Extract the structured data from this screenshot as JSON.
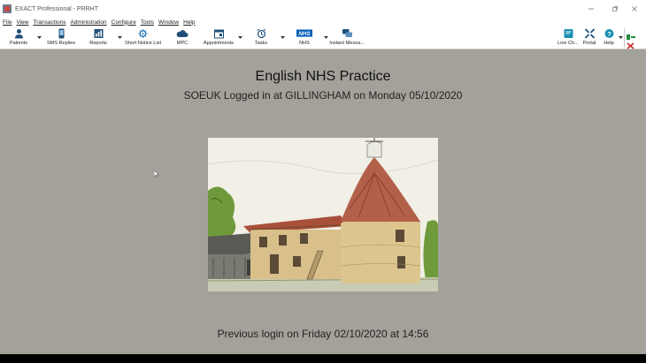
{
  "window": {
    "title": "EXACT Professional - PRRHT"
  },
  "menubar": {
    "items": [
      "File",
      "View",
      "Transactions",
      "Administration",
      "Configure",
      "Tools",
      "Window",
      "Help"
    ]
  },
  "toolbar": {
    "patients": "Patients",
    "sms_replies": "SMS Replies",
    "reports": "Reports",
    "short_notice_list": "Short Notice List",
    "mpc": "MPC",
    "appointments": "Appointments",
    "tasks": "Tasks",
    "nhs": "NHS",
    "nhs_logo_text": "NHS",
    "instant_messages": "Instant Messa...",
    "live_chat": "Live Ch...",
    "portal": "Portal",
    "help": "Help"
  },
  "main": {
    "practice_name": "English NHS Practice",
    "login_line": "SOEUK Logged in at GILLINGHAM on Monday 05/10/2020",
    "previous_login": "Previous login on Friday 02/10/2020 at 14:56"
  },
  "colors": {
    "background": "#a3a199",
    "nhs_blue": "#005eb8",
    "toolbar_icon": "#1f4e79"
  }
}
